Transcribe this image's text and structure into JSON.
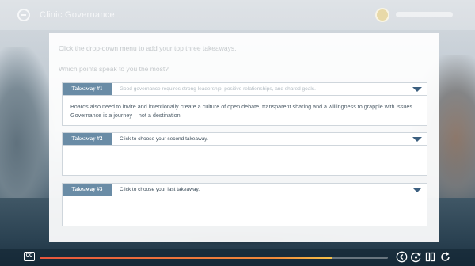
{
  "header": {
    "course_title": "Clinic Governance"
  },
  "content": {
    "instruction": "Click the drop-down menu to add your top three takeaways.",
    "question": "Which points speak to you the most?",
    "takeaways": [
      {
        "label": "Takeaway #1",
        "selection": "Good governance requires strong leadership, positive relationships, and shared goals.",
        "body": "Boards also need to invite and intentionally create a culture of open debate, transparent sharing and a willingness to grapple with issues. Governance is a journey – not a destination."
      },
      {
        "label": "Takeaway #2",
        "selection": "Click to choose your second takeaway.",
        "body": ""
      },
      {
        "label": "Takeaway #3",
        "selection": "Click to choose your last takeaway.",
        "body": ""
      }
    ]
  },
  "player": {
    "cc_label": "CC",
    "progress": 0.84,
    "progress_color": "#e8563d"
  },
  "icons": [
    "logo-icon",
    "user-avatar-icon",
    "chevron-down-icon",
    "closed-captions-icon",
    "back-icon",
    "replay-icon",
    "pause-icon",
    "refresh-icon"
  ]
}
